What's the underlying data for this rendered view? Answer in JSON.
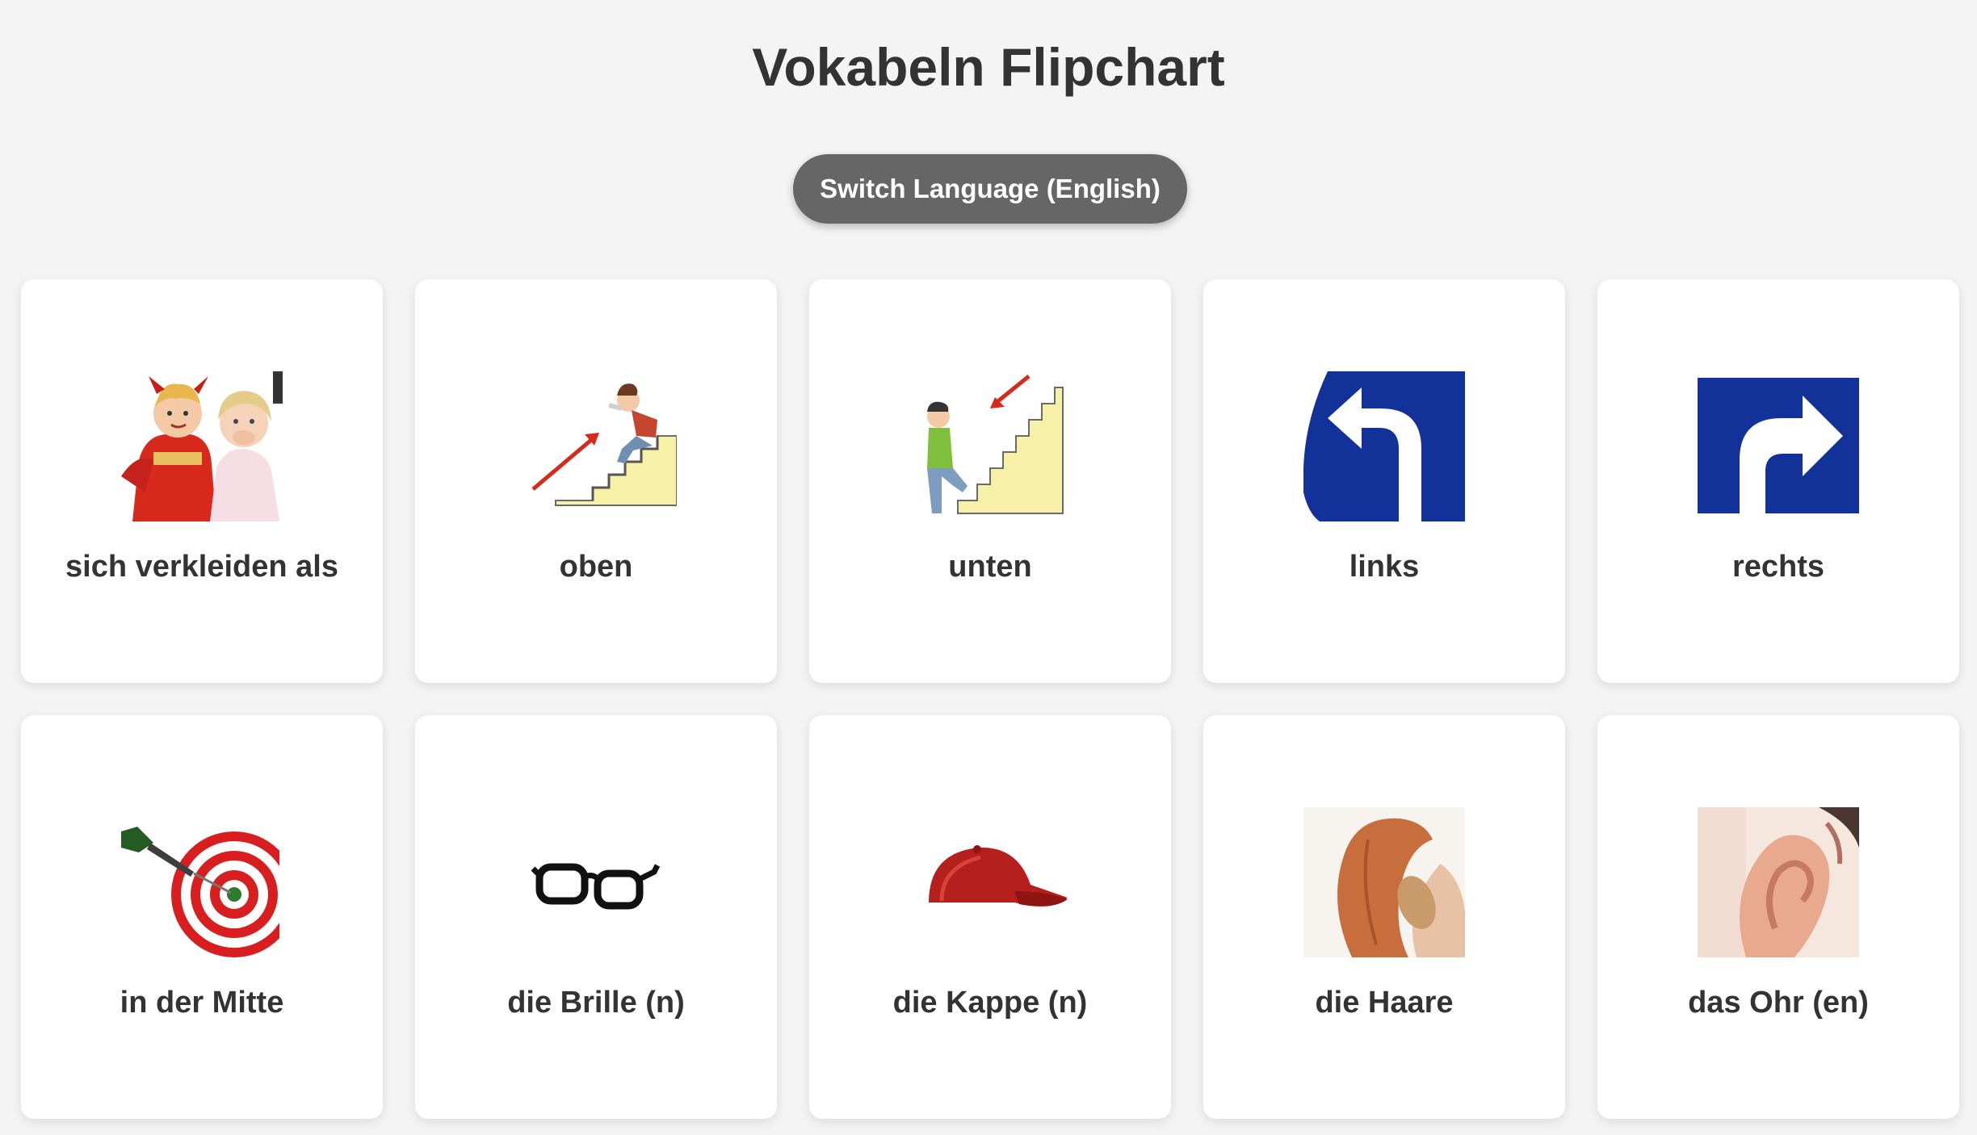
{
  "page": {
    "title": "Vokabeln Flipchart",
    "switch_button_label": "Switch Language (English)"
  },
  "cards": [
    {
      "word": "sich verkleiden als",
      "icon": "costumed-children-icon"
    },
    {
      "word": "oben",
      "icon": "upstairs-icon"
    },
    {
      "word": "unten",
      "icon": "downstairs-icon"
    },
    {
      "word": "links",
      "icon": "left-arrow-sign-icon"
    },
    {
      "word": "rechts",
      "icon": "right-arrow-sign-icon"
    },
    {
      "word": "in der Mitte",
      "icon": "dartboard-icon"
    },
    {
      "word": "die Brille (n)",
      "icon": "glasses-icon"
    },
    {
      "word": "die Kappe (n)",
      "icon": "cap-icon"
    },
    {
      "word": "die Haare",
      "icon": "hair-icon"
    },
    {
      "word": "das Ohr (en)",
      "icon": "ear-icon"
    }
  ],
  "colors": {
    "background": "#f4f4f4",
    "button": "#666666",
    "sign_blue": "#12329a",
    "text": "#333333"
  }
}
